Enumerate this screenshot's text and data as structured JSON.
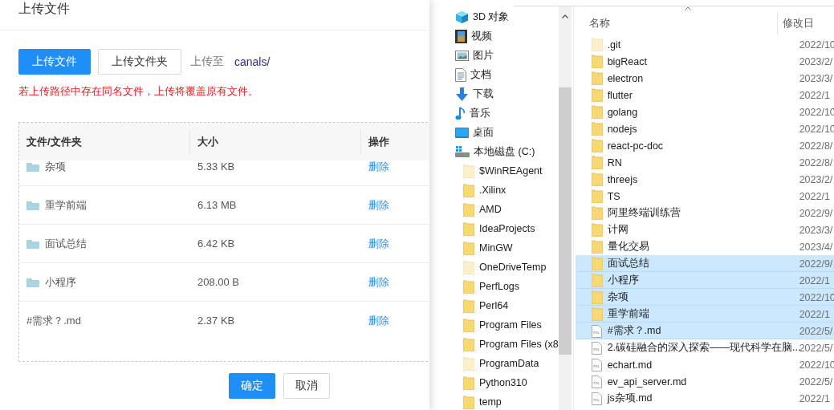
{
  "dialog": {
    "title": "上传文件",
    "buttons": [
      {
        "label": "上传文件",
        "kind": "primary"
      },
      {
        "label": "上传文件夹",
        "kind": "default"
      }
    ],
    "target_label": "上传至",
    "target_path": "canals/",
    "warning": "若上传路径中存在同名文件，上传将覆盖原有文件。",
    "table": {
      "columns": [
        "文件/文件夹",
        "大小",
        "操作"
      ],
      "rows": [
        {
          "name": "杂项",
          "kind": "folder",
          "size": "5.33 KB",
          "action": "删除"
        },
        {
          "name": "重学前端",
          "kind": "folder",
          "size": "6.13 MB",
          "action": "删除"
        },
        {
          "name": "面试总结",
          "kind": "folder",
          "size": "6.42 KB",
          "action": "删除"
        },
        {
          "name": "小程序",
          "kind": "folder",
          "size": "208.00 B",
          "action": "删除"
        },
        {
          "name": "#需求？.md",
          "kind": "file",
          "size": "2.37 KB",
          "action": "删除"
        }
      ]
    },
    "footer_buttons": [
      {
        "label": "确定",
        "kind": "primary"
      },
      {
        "label": "取消",
        "kind": "default"
      }
    ]
  },
  "explorer": {
    "nav_items": [
      {
        "label": "3D 对象",
        "kind": "objects3d"
      },
      {
        "label": "视频",
        "kind": "video"
      },
      {
        "label": "图片",
        "kind": "pictures"
      },
      {
        "label": "文档",
        "kind": "documents"
      },
      {
        "label": "下载",
        "kind": "downloads"
      },
      {
        "label": "音乐",
        "kind": "music"
      },
      {
        "label": "桌面",
        "kind": "desktop"
      },
      {
        "label": "本地磁盘 (C:)",
        "kind": "drive",
        "children": [
          {
            "label": "$WinREAgent",
            "kind": "hidden-folder"
          },
          {
            "label": ".Xilinx",
            "kind": "folder"
          },
          {
            "label": "AMD",
            "kind": "folder"
          },
          {
            "label": "IdeaProjects",
            "kind": "folder"
          },
          {
            "label": "MinGW",
            "kind": "folder"
          },
          {
            "label": "OneDriveTemp",
            "kind": "hidden-folder"
          },
          {
            "label": "PerfLogs",
            "kind": "folder"
          },
          {
            "label": "Perl64",
            "kind": "folder"
          },
          {
            "label": "Program Files",
            "kind": "folder"
          },
          {
            "label": "Program Files (x8",
            "kind": "folder"
          },
          {
            "label": "ProgramData",
            "kind": "hidden-folder"
          },
          {
            "label": "Python310",
            "kind": "folder"
          },
          {
            "label": "temp",
            "kind": "folder"
          }
        ]
      }
    ],
    "columns": [
      "名称",
      "修改日"
    ],
    "files": [
      {
        "name": ".git",
        "kind": "hidden-folder",
        "date": "2022/10",
        "selected": false
      },
      {
        "name": "bigReact",
        "kind": "folder",
        "date": "2023/2/",
        "selected": false
      },
      {
        "name": "electron",
        "kind": "folder",
        "date": "2023/3/",
        "selected": false
      },
      {
        "name": "flutter",
        "kind": "folder",
        "date": "2022/1",
        "selected": false
      },
      {
        "name": "golang",
        "kind": "folder",
        "date": "2022/10",
        "selected": false
      },
      {
        "name": "nodejs",
        "kind": "folder",
        "date": "2022/10",
        "selected": false
      },
      {
        "name": "react-pc-doc",
        "kind": "folder",
        "date": "2022/8/",
        "selected": false
      },
      {
        "name": "RN",
        "kind": "folder",
        "date": "2022/8/",
        "selected": false
      },
      {
        "name": "threejs",
        "kind": "folder",
        "date": "2023/2/",
        "selected": false
      },
      {
        "name": "TS",
        "kind": "folder",
        "date": "2022/1",
        "selected": false
      },
      {
        "name": "阿里终端训练营",
        "kind": "folder",
        "date": "2022/9/",
        "selected": false
      },
      {
        "name": "计网",
        "kind": "folder",
        "date": "2023/3/",
        "selected": false
      },
      {
        "name": "量化交易",
        "kind": "folder",
        "date": "2023/4/",
        "selected": false
      },
      {
        "name": "面试总结",
        "kind": "folder",
        "date": "2022/9/",
        "selected": true
      },
      {
        "name": "小程序",
        "kind": "folder",
        "date": "2022/1",
        "selected": true
      },
      {
        "name": "杂项",
        "kind": "folder",
        "date": "2022/10",
        "selected": true
      },
      {
        "name": "重学前端",
        "kind": "folder",
        "date": "2022/1",
        "selected": true
      },
      {
        "name": "#需求？.md",
        "kind": "md-file",
        "date": "2022/5/",
        "selected": true
      },
      {
        "name": "2.碳硅融合的深入探索——现代科学在脑...",
        "kind": "md-file",
        "date": "2022/5/",
        "selected": false
      },
      {
        "name": "echart.md",
        "kind": "md-file",
        "date": "2022/10",
        "selected": false
      },
      {
        "name": "ev_api_server.md",
        "kind": "md-file",
        "date": "2022/5/",
        "selected": false
      },
      {
        "name": "js杂项.md",
        "kind": "md-file",
        "date": "2022/1",
        "selected": false
      }
    ]
  }
}
